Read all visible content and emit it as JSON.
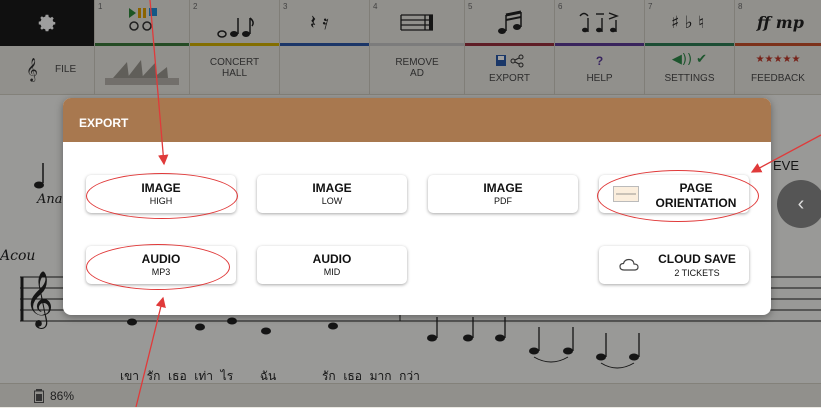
{
  "toolbar": {
    "segments": [
      {
        "num": "1",
        "color": "#3a7a3a"
      },
      {
        "num": "2",
        "color": "#d4b200"
      },
      {
        "num": "3",
        "color": "#2d57a8"
      },
      {
        "num": "4",
        "color": "#c9c9c9"
      },
      {
        "num": "5",
        "color": "#9a2f3e"
      },
      {
        "num": "6",
        "color": "#5d3b96"
      },
      {
        "num": "7",
        "color": "#2e7d55"
      },
      {
        "num": "8",
        "color": "#c8502a"
      }
    ],
    "glyphs": {
      "rests": "𝄽 𝄿",
      "accidentals": "♯ ♭ ♮",
      "dynamics": "ff mp"
    }
  },
  "menu": {
    "file": "FILE",
    "concert_hall": [
      "CONCERT",
      "HALL"
    ],
    "remove_ad": [
      "REMOVE",
      "AD"
    ],
    "export": "EXPORT",
    "help_mark": "?",
    "help": "HELP",
    "settings": "SETTINGS",
    "stars": "★★★★★",
    "feedback": "FEEDBACK"
  },
  "sheet": {
    "left_text_1": "Ana",
    "left_text_2": "Acou",
    "right_text": "EVE",
    "lyrics": "เขา  รัก  เธอ  เท่า  ไร       ฉัน            รัก  เธอ  มาก  กว่า"
  },
  "status": {
    "battery": "86%"
  },
  "dialog": {
    "title": "EXPORT",
    "buttons": [
      {
        "title": "IMAGE",
        "sub": "HIGH"
      },
      {
        "title": "IMAGE",
        "sub": "LOW"
      },
      {
        "title": "IMAGE",
        "sub": "PDF"
      },
      {
        "title": "PAGE",
        "sub": "ORIENTATION"
      },
      {
        "title": "AUDIO",
        "sub": "MP3"
      },
      {
        "title": "AUDIO",
        "sub": "MID"
      },
      {
        "title": "CLOUD SAVE",
        "sub": "2 TICKETS"
      }
    ]
  },
  "colors": {
    "dialog_header": "#a8784f",
    "annotation": "#e03a3a"
  }
}
